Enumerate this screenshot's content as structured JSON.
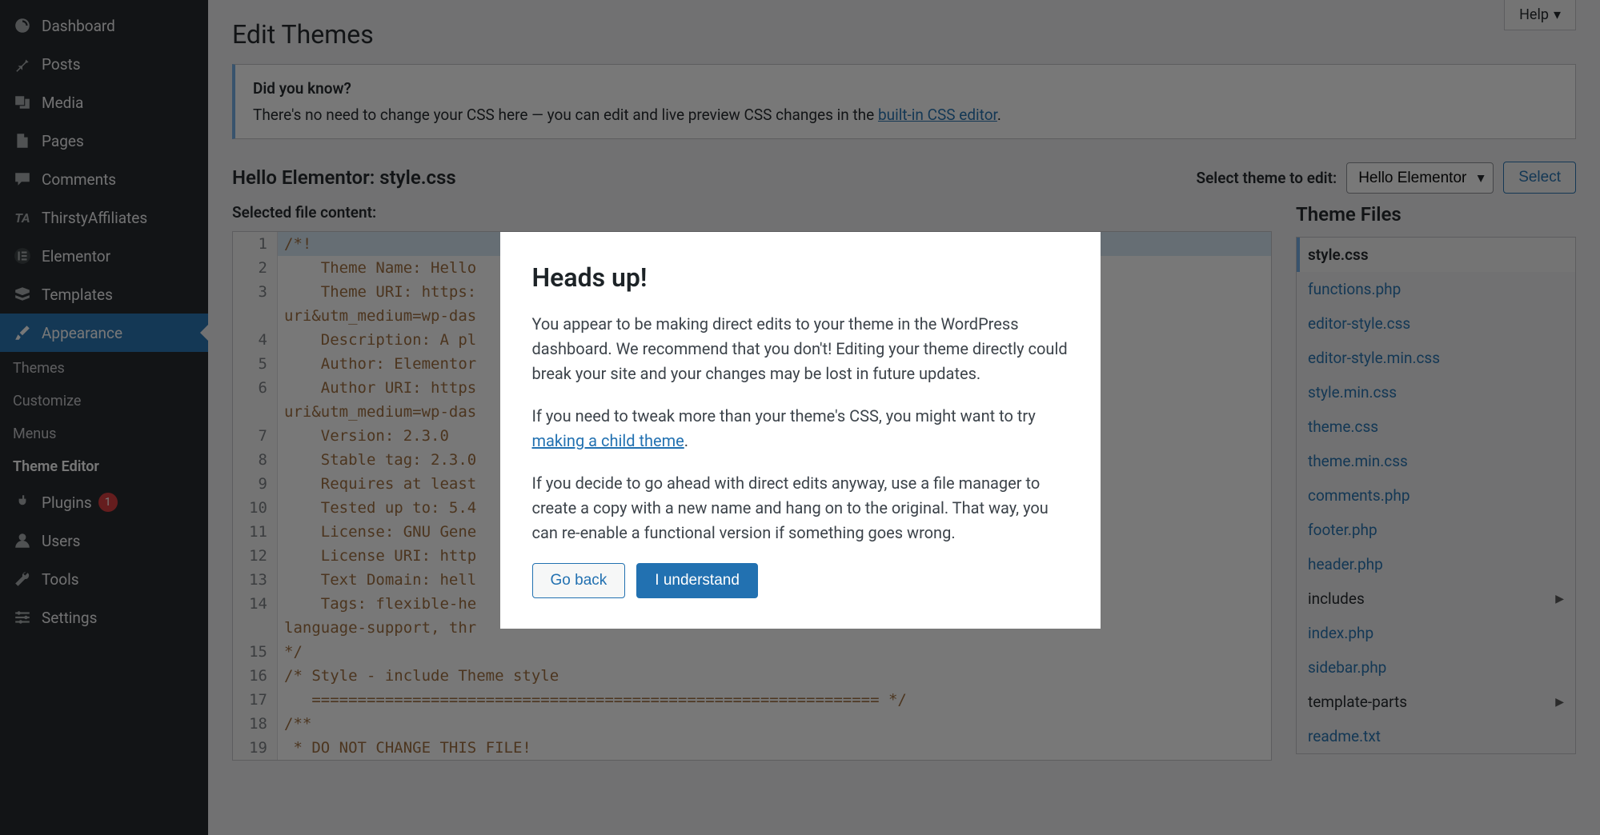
{
  "help_label": "Help",
  "page_title": "Edit Themes",
  "notice": {
    "heading": "Did you know?",
    "text_before": "There's no need to change your CSS here — you can edit and live preview CSS changes in the ",
    "link_text": "built-in CSS editor",
    "text_after": "."
  },
  "file_heading": "Hello Elementor: style.css",
  "theme_select_label": "Select theme to edit:",
  "theme_selected": "Hello Elementor",
  "select_button": "Select",
  "selected_file_label": "Selected file content:",
  "theme_files_heading": "Theme Files",
  "sidebar": {
    "items": [
      {
        "label": "Dashboard",
        "icon": "dashboard"
      },
      {
        "label": "Posts",
        "icon": "pin"
      },
      {
        "label": "Media",
        "icon": "media"
      },
      {
        "label": "Pages",
        "icon": "page"
      },
      {
        "label": "Comments",
        "icon": "comment"
      },
      {
        "label": "ThirstyAffiliates",
        "icon": "ta"
      },
      {
        "label": "Elementor",
        "icon": "elementor"
      },
      {
        "label": "Templates",
        "icon": "templates"
      },
      {
        "label": "Appearance",
        "icon": "brush"
      },
      {
        "label": "Plugins",
        "icon": "plug",
        "badge": "1"
      },
      {
        "label": "Users",
        "icon": "user"
      },
      {
        "label": "Tools",
        "icon": "wrench"
      },
      {
        "label": "Settings",
        "icon": "settings"
      }
    ],
    "subs": [
      {
        "label": "Themes"
      },
      {
        "label": "Customize"
      },
      {
        "label": "Menus"
      },
      {
        "label": "Theme Editor"
      }
    ]
  },
  "code_lines": [
    "/*!",
    "    Theme Name: Hello",
    "    Theme URI: https:                                                       aign=theme-uri&utm_medium=wp-das",
    "    Description: A pl",
    "    Author: Elementor",
    "    Author URI: https                                                       -uri&utm_medium=wp-das",
    "    Version: 2.3.0",
    "    Stable tag: 2.3.0",
    "    Requires at least",
    "    Tested up to: 5.4",
    "    License: GNU Gene",
    "    License URI: http",
    "    Text Domain: hell",
    "    Tags: flexible-he                                                       ages, rtl-language-support, thr",
    "*/",
    "/* Style - include Theme style",
    "   ============================================================== */",
    "/**",
    " * DO NOT CHANGE THIS FILE!"
  ],
  "files": [
    {
      "name": "style.css",
      "active": true
    },
    {
      "name": "functions.php"
    },
    {
      "name": "editor-style.css"
    },
    {
      "name": "editor-style.min.css"
    },
    {
      "name": "style.min.css"
    },
    {
      "name": "theme.css"
    },
    {
      "name": "theme.min.css"
    },
    {
      "name": "comments.php"
    },
    {
      "name": "footer.php"
    },
    {
      "name": "header.php"
    },
    {
      "name": "includes",
      "folder": true
    },
    {
      "name": "index.php"
    },
    {
      "name": "sidebar.php"
    },
    {
      "name": "template-parts",
      "folder": true
    },
    {
      "name": "readme.txt"
    }
  ],
  "modal": {
    "title": "Heads up!",
    "p1": "You appear to be making direct edits to your theme in the WordPress dashboard. We recommend that you don't! Editing your theme directly could break your site and your changes may be lost in future updates.",
    "p2_before": "If you need to tweak more than your theme's CSS, you might want to try ",
    "p2_link": "making a child theme",
    "p2_after": ".",
    "p3": "If you decide to go ahead with direct edits anyway, use a file manager to create a copy with a new name and hang on to the original. That way, you can re-enable a functional version if something goes wrong.",
    "go_back": "Go back",
    "understand": "I understand"
  }
}
